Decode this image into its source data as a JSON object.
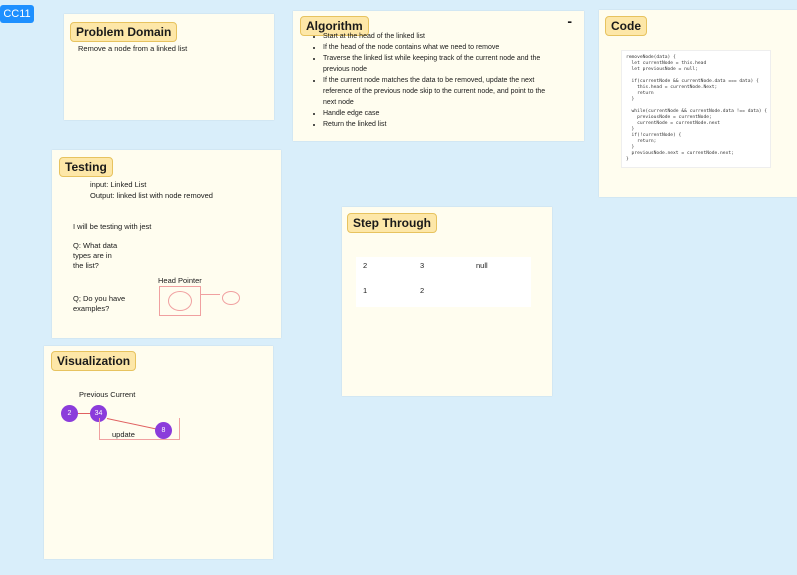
{
  "frame": {
    "label": "CC11"
  },
  "problem": {
    "title": "Problem Domain",
    "text": "Remove a node from a linked list"
  },
  "algorithm": {
    "title": "Algorithm",
    "dash": "-",
    "steps": [
      "Start at the head of the linked list",
      "If the head of the node contains  what we need to remove",
      "Traverse the linked list while keeping track of the current node and the previous node",
      "If the current node matches the data to be removed, update the next reference of the previous node skip to the current node, and point to the next node",
      "Handle edge case",
      "Return the linked list"
    ]
  },
  "code": {
    "title": "Code",
    "lines": [
      "removeNode(data) {",
      "  let currentNode = this.head",
      "  let previousNode = null;",
      "",
      "  if(currentNode && currentNode.data === data) {",
      "    this.head = currentNode.Next;",
      "    return",
      "  }",
      "",
      "  while(currentNode && currentNode.data !== data) {",
      "    previousNode = currentNode;",
      "    currentNode = currentNode.next",
      "  }",
      "  if(!currentNode) {",
      "    return;",
      "  }",
      "  previousNode.next = currentNode.next;",
      "}"
    ]
  },
  "testing": {
    "title": "Testing",
    "input": "input: Linked List",
    "output": "Output: linked list with node removed",
    "jest": "I will be testing with jest",
    "q1": [
      "Q: What data",
      "types are in",
      "the list?"
    ],
    "head_pointer": "Head Pointer",
    "q2": [
      "Q; Do you have",
      "examples?"
    ]
  },
  "step_through": {
    "title": "Step Through",
    "row1": [
      "2",
      "3",
      "null"
    ],
    "row2": [
      "1",
      "2"
    ]
  },
  "visualization": {
    "title": "Visualization",
    "labels": "Previous  Current",
    "node1": "2",
    "node2": "34",
    "node3": "8",
    "update": "update"
  },
  "colors": {
    "background": "#d9eefa",
    "card": "#fffdef",
    "title_bg": "#fde7a8",
    "node": "#8b3cdb",
    "accent": "#1e90ff"
  }
}
